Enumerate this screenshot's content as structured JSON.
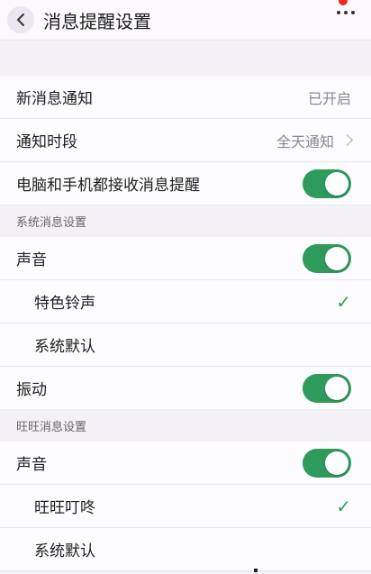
{
  "header": {
    "title": "消息提醒设置"
  },
  "general": {
    "new_msg_label": "新消息通知",
    "new_msg_value": "已开启",
    "period_label": "通知时段",
    "period_value": "全天通知",
    "both_label": "电脑和手机都接收消息提醒",
    "both_on": true
  },
  "system_section": {
    "title": "系统消息设置",
    "sound_label": "声音",
    "sound_on": true,
    "options": [
      "特色铃声",
      "系统默认"
    ],
    "selected": "特色铃声",
    "vibrate_label": "振动",
    "vibrate_on": true
  },
  "wangwang_section": {
    "title": "旺旺消息设置",
    "sound_label": "声音",
    "sound_on": true,
    "options": [
      "旺旺叮咚",
      "系统默认"
    ],
    "selected": "旺旺叮咚"
  },
  "colors": {
    "accent_green": "#2e9a5b",
    "badge_red": "#f2271c"
  }
}
